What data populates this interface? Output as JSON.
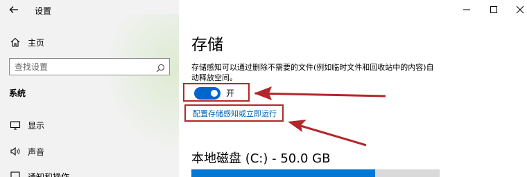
{
  "window": {
    "title": "设置",
    "controls": [
      "minimize",
      "maximize",
      "close"
    ]
  },
  "sidebar": {
    "home_label": "主页",
    "search_placeholder": "查找设置",
    "section_label": "系统",
    "items": [
      {
        "label": "显示",
        "icon": "monitor-icon"
      },
      {
        "label": "声音",
        "icon": "speaker-icon"
      },
      {
        "label": "通知和操作",
        "icon": "notification-icon"
      }
    ]
  },
  "main": {
    "page_title": "存储",
    "description": "存储感知可以通过删除不需要的文件(例如临时文件和回收站中的内容)自动释放空间。",
    "toggle": {
      "state": "on",
      "label": "开"
    },
    "config_link": "配置存储感知或立即运行",
    "disk": {
      "label": "本地磁盘 (C:) - 50.0 GB",
      "used_fraction": 0.74
    }
  },
  "annotations": {
    "highlight_color": "#b3262a"
  },
  "colors": {
    "accent": "#0066cc",
    "link": "#0063b1",
    "sidebar_bg": "#f2f2f2"
  }
}
